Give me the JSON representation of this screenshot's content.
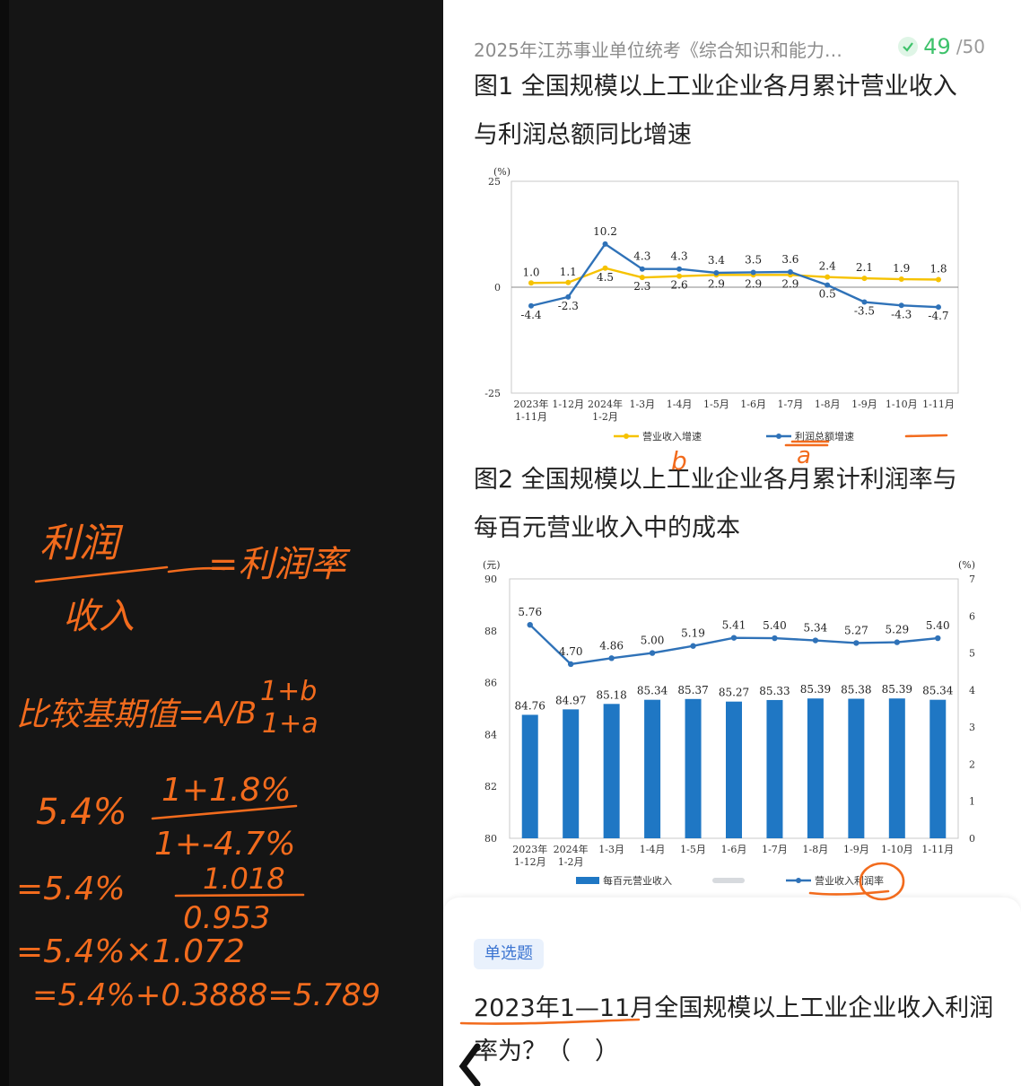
{
  "header": {
    "title": "2025年江苏事业单位统考《综合知识和能力…",
    "progress_current": "49",
    "progress_total": "/50"
  },
  "figure1": {
    "title_line1": "图1  全国规模以上工业企业各月累计营业收入",
    "title_line2": "与利润总额同比增速",
    "chart_data": {
      "type": "line",
      "categories": [
        "2023年 1-11月",
        "1-12月",
        "2024年 1-2月",
        "1-3月",
        "1-4月",
        "1-5月",
        "1-6月",
        "1-7月",
        "1-8月",
        "1-9月",
        "1-10月",
        "1-11月"
      ],
      "unit": "(%)",
      "ylim": [
        -25,
        25
      ],
      "yticks": [
        "25",
        "0",
        "-25"
      ],
      "series": [
        {
          "name": "营业收入增速",
          "color": "#f6c200",
          "values": [
            1.0,
            1.1,
            4.5,
            2.3,
            2.6,
            2.9,
            2.9,
            2.9,
            2.4,
            2.1,
            1.9,
            1.8
          ]
        },
        {
          "name": "利润总额增速",
          "color": "#2f72b8",
          "values": [
            -4.4,
            -2.3,
            10.2,
            4.3,
            4.3,
            3.4,
            3.5,
            3.6,
            0.5,
            -3.5,
            -4.3,
            -4.7
          ]
        }
      ]
    }
  },
  "figure2": {
    "title_line1": "图2  全国规模以上工业企业各月累计利润率与",
    "title_line2": "每百元营业收入中的成本",
    "chart_data": {
      "type": "bar",
      "categories": [
        "2023年 1-12月",
        "2024年 1-2月",
        "1-3月",
        "1-4月",
        "1-5月",
        "1-6月",
        "1-7月",
        "1-8月",
        "1-9月",
        "1-10月",
        "1-11月"
      ],
      "left_unit": "(元)",
      "right_unit": "(%)",
      "ylim_left": [
        80,
        90
      ],
      "ylim_right": [
        0,
        7
      ],
      "yticks_left": [
        "90",
        "88",
        "86",
        "84",
        "82",
        "80"
      ],
      "yticks_right": [
        "7",
        "6",
        "5",
        "4",
        "3",
        "2",
        "1",
        "0"
      ],
      "series": [
        {
          "name": "每百元营业收入",
          "type": "bar",
          "color": "#1f77c4",
          "values": [
            84.76,
            84.97,
            85.18,
            85.34,
            85.37,
            85.27,
            85.33,
            85.39,
            85.38,
            85.39,
            85.34
          ]
        },
        {
          "name": "营业收入利润率",
          "type": "line",
          "color": "#2f72b8",
          "values": [
            5.76,
            4.7,
            4.86,
            5.0,
            5.19,
            5.41,
            5.4,
            5.34,
            5.27,
            5.29,
            5.4
          ]
        }
      ]
    }
  },
  "question": {
    "type_badge": "单选题",
    "text": "2023年1—11月全国规模以上工业企业收入利润率为？（　）"
  },
  "annotations": {
    "fig_marks": [
      "b",
      "a"
    ],
    "notes": [
      "利润",
      "收入",
      "=利润率",
      "比较基期值=",
      "A/B",
      "1+b",
      "1+a",
      "5.4%",
      "1+1.8%",
      "1+-4.7%",
      "=5.4%",
      "1.018",
      "0.953",
      "=5.4%×1.072",
      "=5.4%+0.3888=5.789"
    ]
  }
}
